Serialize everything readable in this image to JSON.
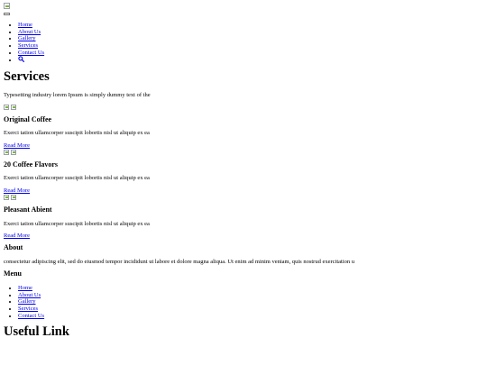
{
  "header": {
    "nav": [
      "Home",
      "About Us",
      "Gallery",
      "Services",
      "Contact Us"
    ],
    "search_icon": "search-icon"
  },
  "services": {
    "title": "Services",
    "lead": "Typesetting industry lorem Ipsum is simply dummy text of the",
    "cards": [
      {
        "title": "Original Coffee",
        "text": "Exerci tation ullamcorper suscipit lobortis nisl ut aliquip ex ea",
        "link": "Read More"
      },
      {
        "title": "20 Coffee Flavors",
        "text": "Exerci tation ullamcorper suscipit lobortis nisl ut aliquip ex ea",
        "link": "Read More"
      },
      {
        "title": "Pleasant Abient",
        "text": "Exerci tation ullamcorper suscipit lobortis nisl ut aliquip ex ea",
        "link": "Read More"
      }
    ]
  },
  "footer": {
    "about_title": "About",
    "about_text": "consectetur adipiscing elit, sed do eiusmod tempor incididunt ut labore et dolore magna aliqua. Ut enim ad minim veniam, quis nostrud exercitation u",
    "menu_title": "Menu",
    "menu": [
      "Home",
      "About Us",
      "Gallery",
      "Services",
      "Contact Us"
    ],
    "useful_title": "Useful Link"
  }
}
